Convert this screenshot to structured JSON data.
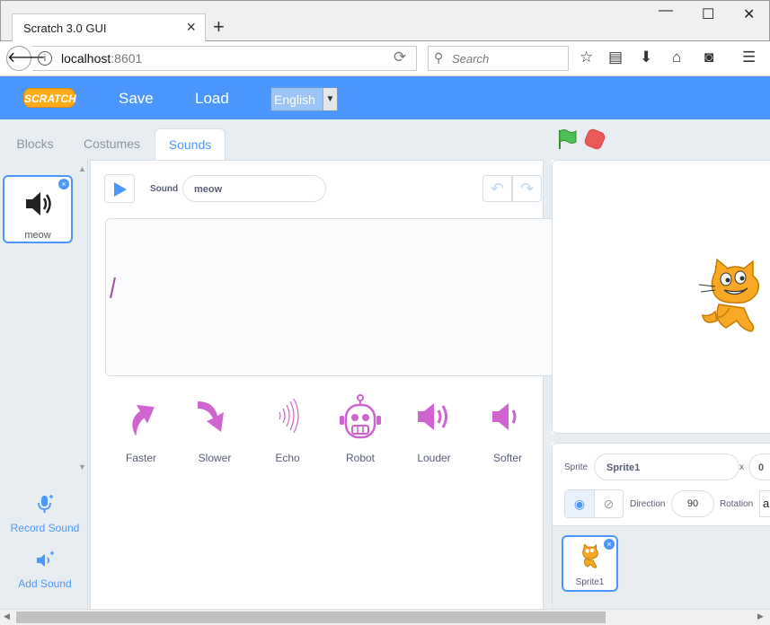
{
  "browser": {
    "tab_title": "Scratch 3.0 GUI",
    "new_tab": "+",
    "url_host": "localhost",
    "url_port": ":8601",
    "search_placeholder": "Search",
    "window_controls": [
      "minimize",
      "maximize",
      "close"
    ]
  },
  "menu": {
    "logo": "SCRATCH",
    "save": "Save",
    "load": "Load",
    "language": "English"
  },
  "editor_tabs": {
    "blocks": "Blocks",
    "costumes": "Costumes",
    "sounds": "Sounds",
    "active": "sounds"
  },
  "sound_list": {
    "items": [
      {
        "name": "meow"
      }
    ],
    "record_label": "Record Sound",
    "add_label": "Add Sound"
  },
  "sound_editor": {
    "name_label": "Sound",
    "name_value": "meow",
    "effects": [
      {
        "label": "Faster",
        "icon": "faster-icon"
      },
      {
        "label": "Slower",
        "icon": "slower-icon"
      },
      {
        "label": "Echo",
        "icon": "echo-icon"
      },
      {
        "label": "Robot",
        "icon": "robot-icon"
      },
      {
        "label": "Louder",
        "icon": "louder-icon"
      },
      {
        "label": "Softer",
        "icon": "softer-icon"
      }
    ]
  },
  "sprite_info": {
    "sprite_label": "Sprite",
    "sprite_name": "Sprite1",
    "x_label": "x",
    "x_value": "0",
    "direction_label": "Direction",
    "direction_value": "90",
    "rotation_label": "Rotation",
    "rotation_value": "a"
  },
  "sprites": [
    {
      "name": "Sprite1"
    }
  ],
  "colors": {
    "accent": "#4c97ff",
    "effect": "#cf63cf",
    "background": "#e8edf1"
  }
}
